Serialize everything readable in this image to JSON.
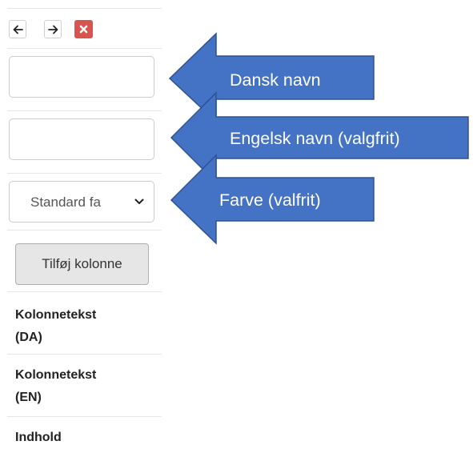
{
  "toolbar": {
    "back_icon": "arrow-left-icon",
    "forward_icon": "arrow-right-icon",
    "delete_icon": "close-icon",
    "delete_color": "#d9534f"
  },
  "form": {
    "danish_name_value": "",
    "english_name_value": "",
    "color_select_value": "Standard fa",
    "add_column_label": "Tilføj kolonne"
  },
  "columns": {
    "header_da_line1": "Kolonnetekst",
    "header_da_line2": "(DA)",
    "header_en_line1": "Kolonnetekst",
    "header_en_line2": "(EN)",
    "header_content": "Indhold"
  },
  "annotations": {
    "arrow_color": "#4472c4",
    "arrow_outline": "#2f528f",
    "danish_label": "Dansk navn",
    "english_label": "Engelsk navn (valgfrit)",
    "color_label": "Farve (valfrit)"
  }
}
